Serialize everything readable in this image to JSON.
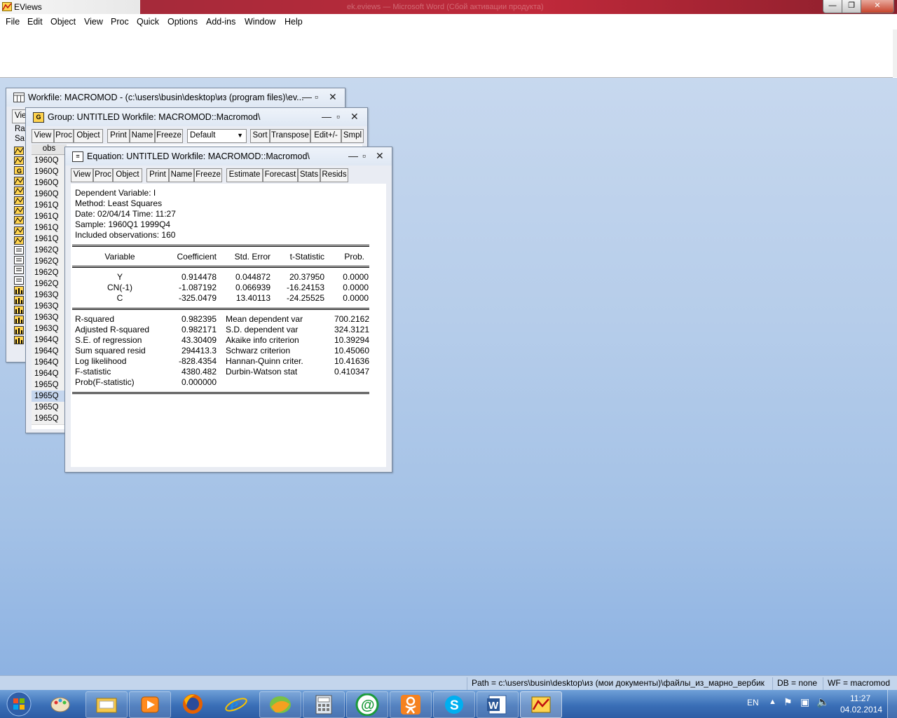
{
  "app": {
    "title": "EViews",
    "blurred_title": "ek.eviews — Microsoft Word (Сбой активации продукта)"
  },
  "menu": [
    "File",
    "Edit",
    "Object",
    "View",
    "Proc",
    "Quick",
    "Options",
    "Add-ins",
    "Window",
    "Help"
  ],
  "caption_buttons": {
    "minimize": "—",
    "restore": "❐",
    "close": "✕"
  },
  "workfile_window": {
    "title": "Workfile: MACROMOD - (c:\\users\\busin\\desktop\\из (program files)\\ev...",
    "toolbar_partial": "Vie",
    "labels": [
      "Ra",
      "Sa"
    ]
  },
  "group_window": {
    "icon_letter": "G",
    "title": "Group: UNTITLED   Workfile: MACROMOD::Macromod\\",
    "toolbar": [
      "View",
      "Proc",
      "Object",
      "Print",
      "Name",
      "Freeze",
      "Sort",
      "Transpose",
      "Edit+/-",
      "Smpl"
    ],
    "dropdown_value": "Default",
    "column_header": "obs",
    "rows": [
      "1960Q",
      "1960Q",
      "1960Q",
      "1960Q",
      "1961Q",
      "1961Q",
      "1961Q",
      "1961Q",
      "1962Q",
      "1962Q",
      "1962Q",
      "1962Q",
      "1963Q",
      "1963Q",
      "1963Q",
      "1963Q",
      "1964Q",
      "1964Q",
      "1964Q",
      "1964Q",
      "1965Q",
      "1965Q",
      "1965Q",
      "1965Q"
    ]
  },
  "equation_window": {
    "title": "Equation: UNTITLED   Workfile: MACROMOD::Macromod\\",
    "toolbar": [
      "View",
      "Proc",
      "Object",
      "Print",
      "Name",
      "Freeze",
      "Estimate",
      "Forecast",
      "Stats",
      "Resids"
    ],
    "header_lines": [
      "Dependent Variable: I",
      "Method: Least Squares",
      "Date: 02/04/14   Time: 11:27",
      "Sample: 1960Q1 1999Q4",
      "Included observations: 160"
    ],
    "columns": [
      "Variable",
      "Coefficient",
      "Std. Error",
      "t-Statistic",
      "Prob."
    ],
    "coefficients": [
      {
        "variable": "Y",
        "coef": "0.914478",
        "se": "0.044872",
        "t": "20.37950",
        "p": "0.0000"
      },
      {
        "variable": "CN(-1)",
        "coef": "-1.087192",
        "se": "0.066939",
        "t": "-16.24153",
        "p": "0.0000"
      },
      {
        "variable": "C",
        "coef": "-325.0479",
        "se": "13.40113",
        "t": "-24.25525",
        "p": "0.0000"
      }
    ],
    "stats_left": [
      {
        "label": "R-squared",
        "value": "0.982395"
      },
      {
        "label": "Adjusted R-squared",
        "value": "0.982171"
      },
      {
        "label": "S.E. of regression",
        "value": "43.30409"
      },
      {
        "label": "Sum squared resid",
        "value": "294413.3"
      },
      {
        "label": "Log likelihood",
        "value": "-828.4354"
      },
      {
        "label": "F-statistic",
        "value": "4380.482"
      },
      {
        "label": "Prob(F-statistic)",
        "value": "0.000000"
      }
    ],
    "stats_right": [
      {
        "label": "Mean dependent var",
        "value": "700.2162"
      },
      {
        "label": "S.D. dependent var",
        "value": "324.3121"
      },
      {
        "label": "Akaike info criterion",
        "value": "10.39294"
      },
      {
        "label": "Schwarz criterion",
        "value": "10.45060"
      },
      {
        "label": "Hannan-Quinn criter.",
        "value": "10.41636"
      },
      {
        "label": "Durbin-Watson stat",
        "value": "0.410347"
      }
    ]
  },
  "statusbar": {
    "path": "Path = c:\\users\\busin\\desktop\\из (мои документы)\\файлы_из_марно_вербик",
    "db": "DB = none",
    "wf": "WF = macromod"
  },
  "taskbar": {
    "apps": [
      "start-orb",
      "paint-icon",
      "explorer-icon",
      "media-player-icon",
      "firefox-icon",
      "ie-icon",
      "app-green-icon",
      "calculator-icon",
      "mail-ru-agent-icon",
      "odnoklassniki-icon",
      "skype-icon",
      "word-icon",
      "eviews-icon"
    ],
    "lang": "EN",
    "time": "11:27",
    "date": "04.02.2014"
  },
  "colors": {
    "desktop": "#b6cdea",
    "taskbar": "#3a6fb7",
    "titlebar_accent": "#c0293a",
    "highlight_row": "#c5d6ee"
  }
}
